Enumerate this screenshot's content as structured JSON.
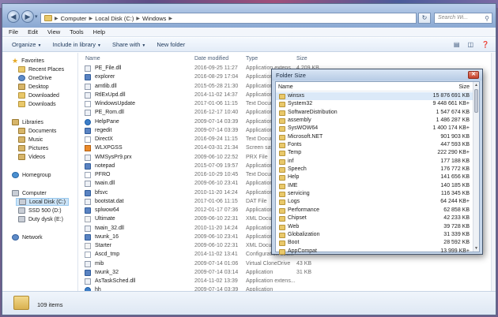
{
  "address": {
    "crumbs": [
      "Computer",
      "Local Disk (C:)",
      "Windows"
    ],
    "search_placeholder": "Search Wi..."
  },
  "menu": [
    "File",
    "Edit",
    "View",
    "Tools",
    "Help"
  ],
  "toolbar": {
    "organize": "Organize",
    "include": "Include in library",
    "share": "Share with",
    "new_folder": "New folder"
  },
  "nav": {
    "favorites": "Favorites",
    "recent": "Recent Places",
    "onedrive": "OneDrive",
    "desktop": "Desktop",
    "downloaded": "Downloaded",
    "downloads": "Downloads",
    "libraries": "Libraries",
    "documents": "Documents",
    "music": "Music",
    "pictures": "Pictures",
    "videos": "Videos",
    "homegroup": "Homegroup",
    "computer": "Computer",
    "local_disk": "Local Disk (C:)",
    "ssd": "SSD 500 (D:)",
    "duty": "Duty dysk (E:)",
    "network": "Network"
  },
  "columns": {
    "name": "Name",
    "date": "Date modified",
    "type": "Type",
    "size": "Size"
  },
  "files": [
    {
      "name": "PE_File.dll",
      "date": "2016-09-25 11:27",
      "type": "Application extens...",
      "size": "4 209 KB",
      "icon": "dll"
    },
    {
      "name": "explorer",
      "date": "2016-08-29 17:04",
      "type": "Application",
      "size": "",
      "icon": "exe"
    },
    {
      "name": "amtlib.dll",
      "date": "2015-05-28 21:30",
      "type": "Application extens...",
      "size": "",
      "icon": "dll"
    },
    {
      "name": "RtlExUpd.dll",
      "date": "2014-11-02 14:37",
      "type": "Application extens...",
      "size": "",
      "icon": "dll"
    },
    {
      "name": "WindowsUpdate",
      "date": "2017-01-06 11:15",
      "type": "Text Document",
      "size": "",
      "icon": "text"
    },
    {
      "name": "PE_Rom.dll",
      "date": "2016-12-17 10:40",
      "type": "Application extens...",
      "size": "",
      "icon": "dll"
    },
    {
      "name": "HelpPane",
      "date": "2009-07-14 03:39",
      "type": "Application",
      "size": "",
      "icon": "help"
    },
    {
      "name": "regedit",
      "date": "2009-07-14 03:39",
      "type": "Application",
      "size": "",
      "icon": "exe"
    },
    {
      "name": "DirectX",
      "date": "2016-09-24 11:15",
      "type": "Text Document",
      "size": "",
      "icon": "text"
    },
    {
      "name": "WLXPGSS",
      "date": "2014-03-31 21:34",
      "type": "Screen saver",
      "size": "",
      "icon": "scr"
    },
    {
      "name": "WMSysPr9.prx",
      "date": "2009-06-10 22:52",
      "type": "PRX File",
      "size": "",
      "icon": "dll"
    },
    {
      "name": "notepad",
      "date": "2015-07-09 19:57",
      "type": "Application",
      "size": "",
      "icon": "exe"
    },
    {
      "name": "PFRO",
      "date": "2016-10-29 10:45",
      "type": "Text Document",
      "size": "",
      "icon": "text"
    },
    {
      "name": "twain.dll",
      "date": "2009-06-10 23:41",
      "type": "Application extens...",
      "size": "",
      "icon": "dll"
    },
    {
      "name": "bfsvc",
      "date": "2010-11-20 14:24",
      "type": "Application",
      "size": "",
      "icon": "exe"
    },
    {
      "name": "bootstat.dat",
      "date": "2017-01-06 11:15",
      "type": "DAT File",
      "size": "",
      "icon": "dll"
    },
    {
      "name": "splwow64",
      "date": "2012-01-17 07:36",
      "type": "Application",
      "size": "",
      "icon": "exe"
    },
    {
      "name": "Ultimate",
      "date": "2009-06-10 22:31",
      "type": "XML Document",
      "size": "",
      "icon": "xml"
    },
    {
      "name": "twain_32.dll",
      "date": "2010-11-20 14:24",
      "type": "Application extens...",
      "size": "",
      "icon": "dll"
    },
    {
      "name": "twunk_16",
      "date": "2009-06-10 23:41",
      "type": "Application",
      "size": "",
      "icon": "exe"
    },
    {
      "name": "Starter",
      "date": "2009-06-10 22:31",
      "type": "XML Document",
      "size": "",
      "icon": "xml"
    },
    {
      "name": "Ascd_tmp",
      "date": "2014-11-02 13:41",
      "type": "Configuration sett...",
      "size": "",
      "icon": "text"
    },
    {
      "name": "mib",
      "date": "2009-07-14 01:06",
      "type": "Virtual CloneDrive",
      "size": "43 KB",
      "icon": "dll"
    },
    {
      "name": "twunk_32",
      "date": "2009-07-14 03:14",
      "type": "Application",
      "size": "31 KB",
      "icon": "exe"
    },
    {
      "name": "AsTaskSched.dll",
      "date": "2014-11-02 13:39",
      "type": "Application extens...",
      "size": "",
      "icon": "dll"
    },
    {
      "name": "hh",
      "date": "2009-07-14 03:39",
      "type": "Application",
      "size": "",
      "icon": "help"
    }
  ],
  "status": {
    "count": "109 items"
  },
  "folder_size": {
    "title": "Folder Size",
    "col_name": "Name",
    "col_size": "Size",
    "rows": [
      {
        "name": "winsxs",
        "size": "15 876 691 KB"
      },
      {
        "name": "System32",
        "size": "9 448 661 KB+"
      },
      {
        "name": "SoftwareDistribution",
        "size": "1 547 674 KB"
      },
      {
        "name": "assembly",
        "size": "1 486 287 KB"
      },
      {
        "name": "SysWOW64",
        "size": "1 400 174 KB+"
      },
      {
        "name": "Microsoft.NET",
        "size": "901 903 KB"
      },
      {
        "name": "Fonts",
        "size": "447 593 KB"
      },
      {
        "name": "Temp",
        "size": "222 290 KB+"
      },
      {
        "name": "inf",
        "size": "177 188 KB"
      },
      {
        "name": "Speech",
        "size": "176 772 KB"
      },
      {
        "name": "Help",
        "size": "141 656 KB"
      },
      {
        "name": "IME",
        "size": "140 185 KB"
      },
      {
        "name": "servicing",
        "size": "116 345 KB"
      },
      {
        "name": "Logs",
        "size": "64 244 KB+"
      },
      {
        "name": "Performance",
        "size": "62 858 KB"
      },
      {
        "name": "Chipset",
        "size": "42 233 KB"
      },
      {
        "name": "Web",
        "size": "39 728 KB"
      },
      {
        "name": "Globalization",
        "size": "31 339 KB"
      },
      {
        "name": "Boot",
        "size": "28 592 KB"
      },
      {
        "name": "AppCompat",
        "size": "13 999 KB+"
      }
    ]
  }
}
